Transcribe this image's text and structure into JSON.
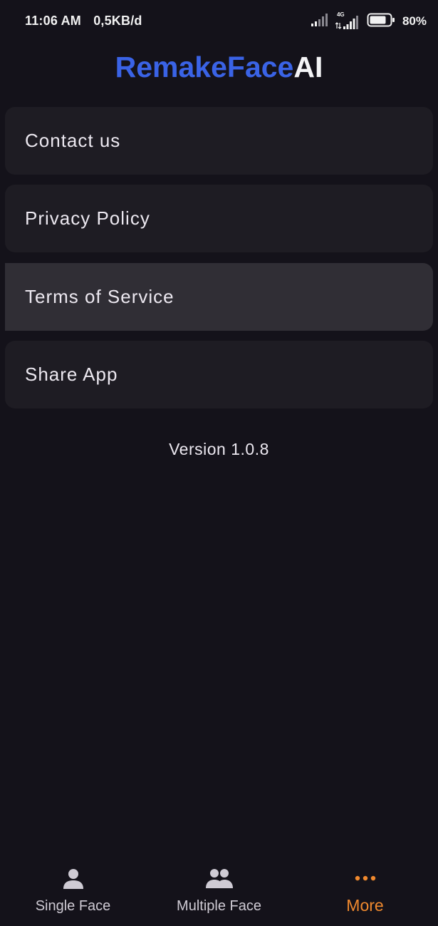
{
  "status_bar": {
    "time": "11:06 AM",
    "data_rate": "0,5KB/d",
    "network_type": "4G",
    "battery_percent": "80%",
    "icons": [
      "signal-icon",
      "signal-4g-icon",
      "battery-icon"
    ]
  },
  "header": {
    "title_primary": "RemakeFace",
    "title_secondary": "AI",
    "colors": {
      "primary": "#3a63e6",
      "secondary": "#f4f4f6"
    }
  },
  "menu": {
    "items": [
      {
        "label": "Contact us"
      },
      {
        "label": "Privacy Policy"
      },
      {
        "label": "Terms of Service"
      },
      {
        "label": "Share App"
      }
    ],
    "highlighted_item": "Terms of Service"
  },
  "version_text": "Version 1.0.8",
  "bottom_nav": {
    "items": [
      {
        "label": "Single Face",
        "icon": "person-icon",
        "active": false
      },
      {
        "label": "Multiple Face",
        "icon": "people-icon",
        "active": false
      },
      {
        "label": "More",
        "icon": "more-dots-icon",
        "active": true
      }
    ],
    "active_color": "#f0892e"
  },
  "theme": {
    "background": "#14121a",
    "card": "#1e1c23",
    "card_highlight": "#302e35"
  }
}
